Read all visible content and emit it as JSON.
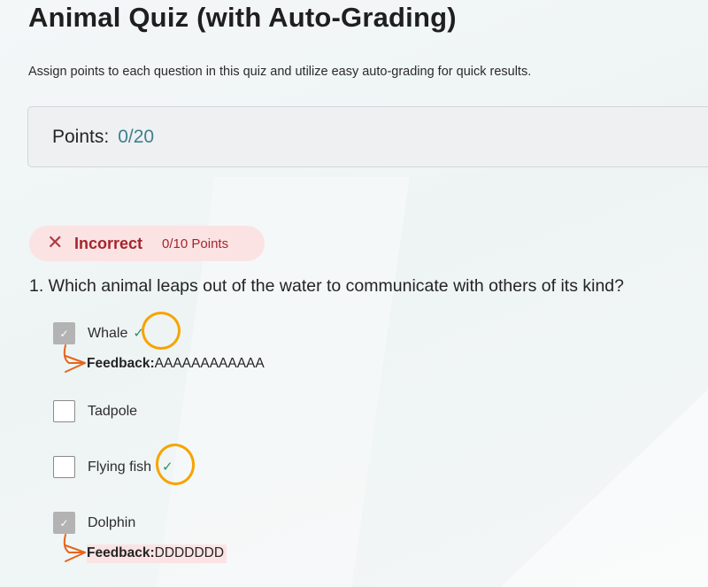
{
  "page": {
    "title": "Animal Quiz (with Auto-Grading)",
    "subtitle": "Assign points to each question in this quiz and utilize easy auto-grading for quick results."
  },
  "points": {
    "label": "Points:",
    "value": "0/20"
  },
  "result": {
    "icon": "close-icon",
    "status": "Incorrect",
    "points": "0/10 Points",
    "color": "#a4262c",
    "background": "#fbe3e4"
  },
  "question": {
    "text": "1. Which animal leaps out of the water to communicate with others of its kind?",
    "options": [
      {
        "label": "Whale",
        "checked": true,
        "correct": true
      },
      {
        "label": "Tadpole",
        "checked": false,
        "correct": false
      },
      {
        "label": "Flying fish",
        "checked": false,
        "correct": true
      },
      {
        "label": "Dolphin",
        "checked": true,
        "correct": false
      }
    ],
    "feedback": [
      {
        "label": "Feedback:",
        "text": "AAAAAAAAAAAA"
      },
      {
        "label": "Feedback:",
        "text": "DDDDDDD"
      }
    ]
  },
  "colors": {
    "correct_check": "#2f8f5c",
    "annotation": "#f5a400",
    "arrow": "#e8641b",
    "points_value": "#3f7f8f"
  }
}
